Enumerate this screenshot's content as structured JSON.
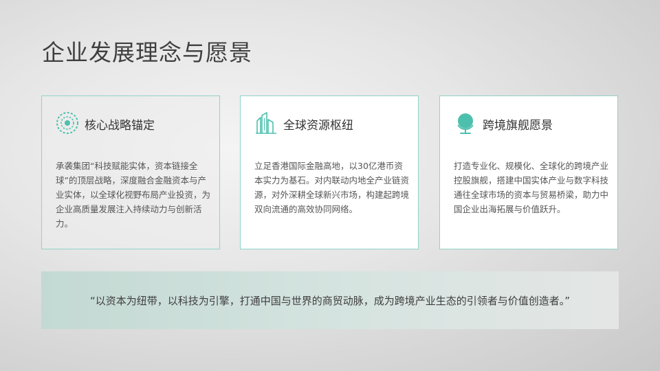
{
  "title": "企业发展理念与愿景",
  "cards": [
    {
      "icon": "radar-target-icon",
      "heading": "核心战略锚定",
      "body": "承袭集团“科技赋能实体，资本链接全球”的顶层战略，深度融合金融资本与产业实体，以全球化视野布局产业投资，为企业高质量发展注入持续动力与创新活力。"
    },
    {
      "icon": "buildings-icon",
      "heading": "全球资源枢纽",
      "body": "立足香港国际金融高地，以30亿港币资本实力为基石。对内联动内地全产业链资源，对外深耕全球新兴市场，构建起跨境双向流通的高效协同网络。"
    },
    {
      "icon": "globe-icon",
      "heading": "跨境旗舰愿景",
      "body": "打造专业化、规模化、全球化的跨境产业控股旗舰，搭建中国实体产业与数字科技通往全球市场的资本与贸易桥梁，助力中国企业出海拓展与价值跃升。"
    }
  ],
  "quote": "“以资本为纽带，以科技为引擎，打通中国与世界的商贸动脉，成为跨境产业生态的引领者与价值创造者。”",
  "colors": {
    "accent": "#4cc0ad",
    "card_border": "#8fd3c6",
    "title_text": "#3f3f3f",
    "body_text": "#555555"
  }
}
